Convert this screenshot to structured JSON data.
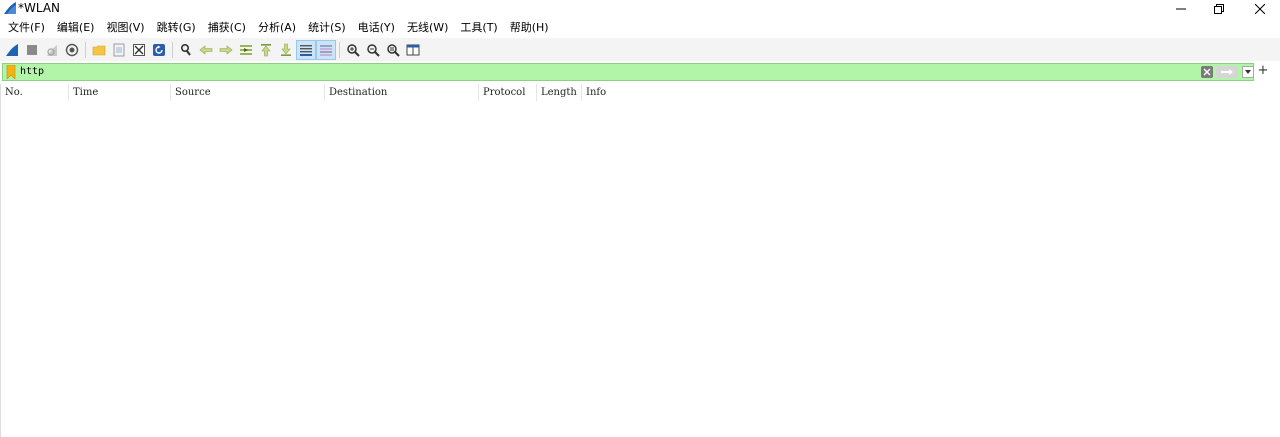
{
  "window": {
    "title": "*WLAN",
    "controls": [
      "minimize",
      "restore",
      "close"
    ]
  },
  "menubar": {
    "items": [
      "文件(F)",
      "编辑(E)",
      "视图(V)",
      "跳转(G)",
      "捕获(C)",
      "分析(A)",
      "统计(S)",
      "电话(Y)",
      "无线(W)",
      "工具(T)",
      "帮助(H)"
    ]
  },
  "toolbar": {
    "icons": [
      "start-capture-icon",
      "stop-capture-icon",
      "restart-capture-icon",
      "capture-options-icon",
      "open-file-icon",
      "save-file-icon",
      "close-file-icon",
      "reload-file-icon",
      "find-packet-icon",
      "go-back-icon",
      "go-forward-icon",
      "go-to-packet-icon",
      "first-packet-icon",
      "last-packet-icon",
      "autoscroll-icon",
      "colorize-icon",
      "zoom-in-icon",
      "zoom-out-icon",
      "normal-size-icon",
      "resize-columns-icon"
    ]
  },
  "filter": {
    "value": "http",
    "color": "#b3f5a8"
  },
  "packet_list": {
    "columns": [
      "No.",
      "Time",
      "Source",
      "Destination",
      "Protocol",
      "Length",
      "Info"
    ]
  }
}
